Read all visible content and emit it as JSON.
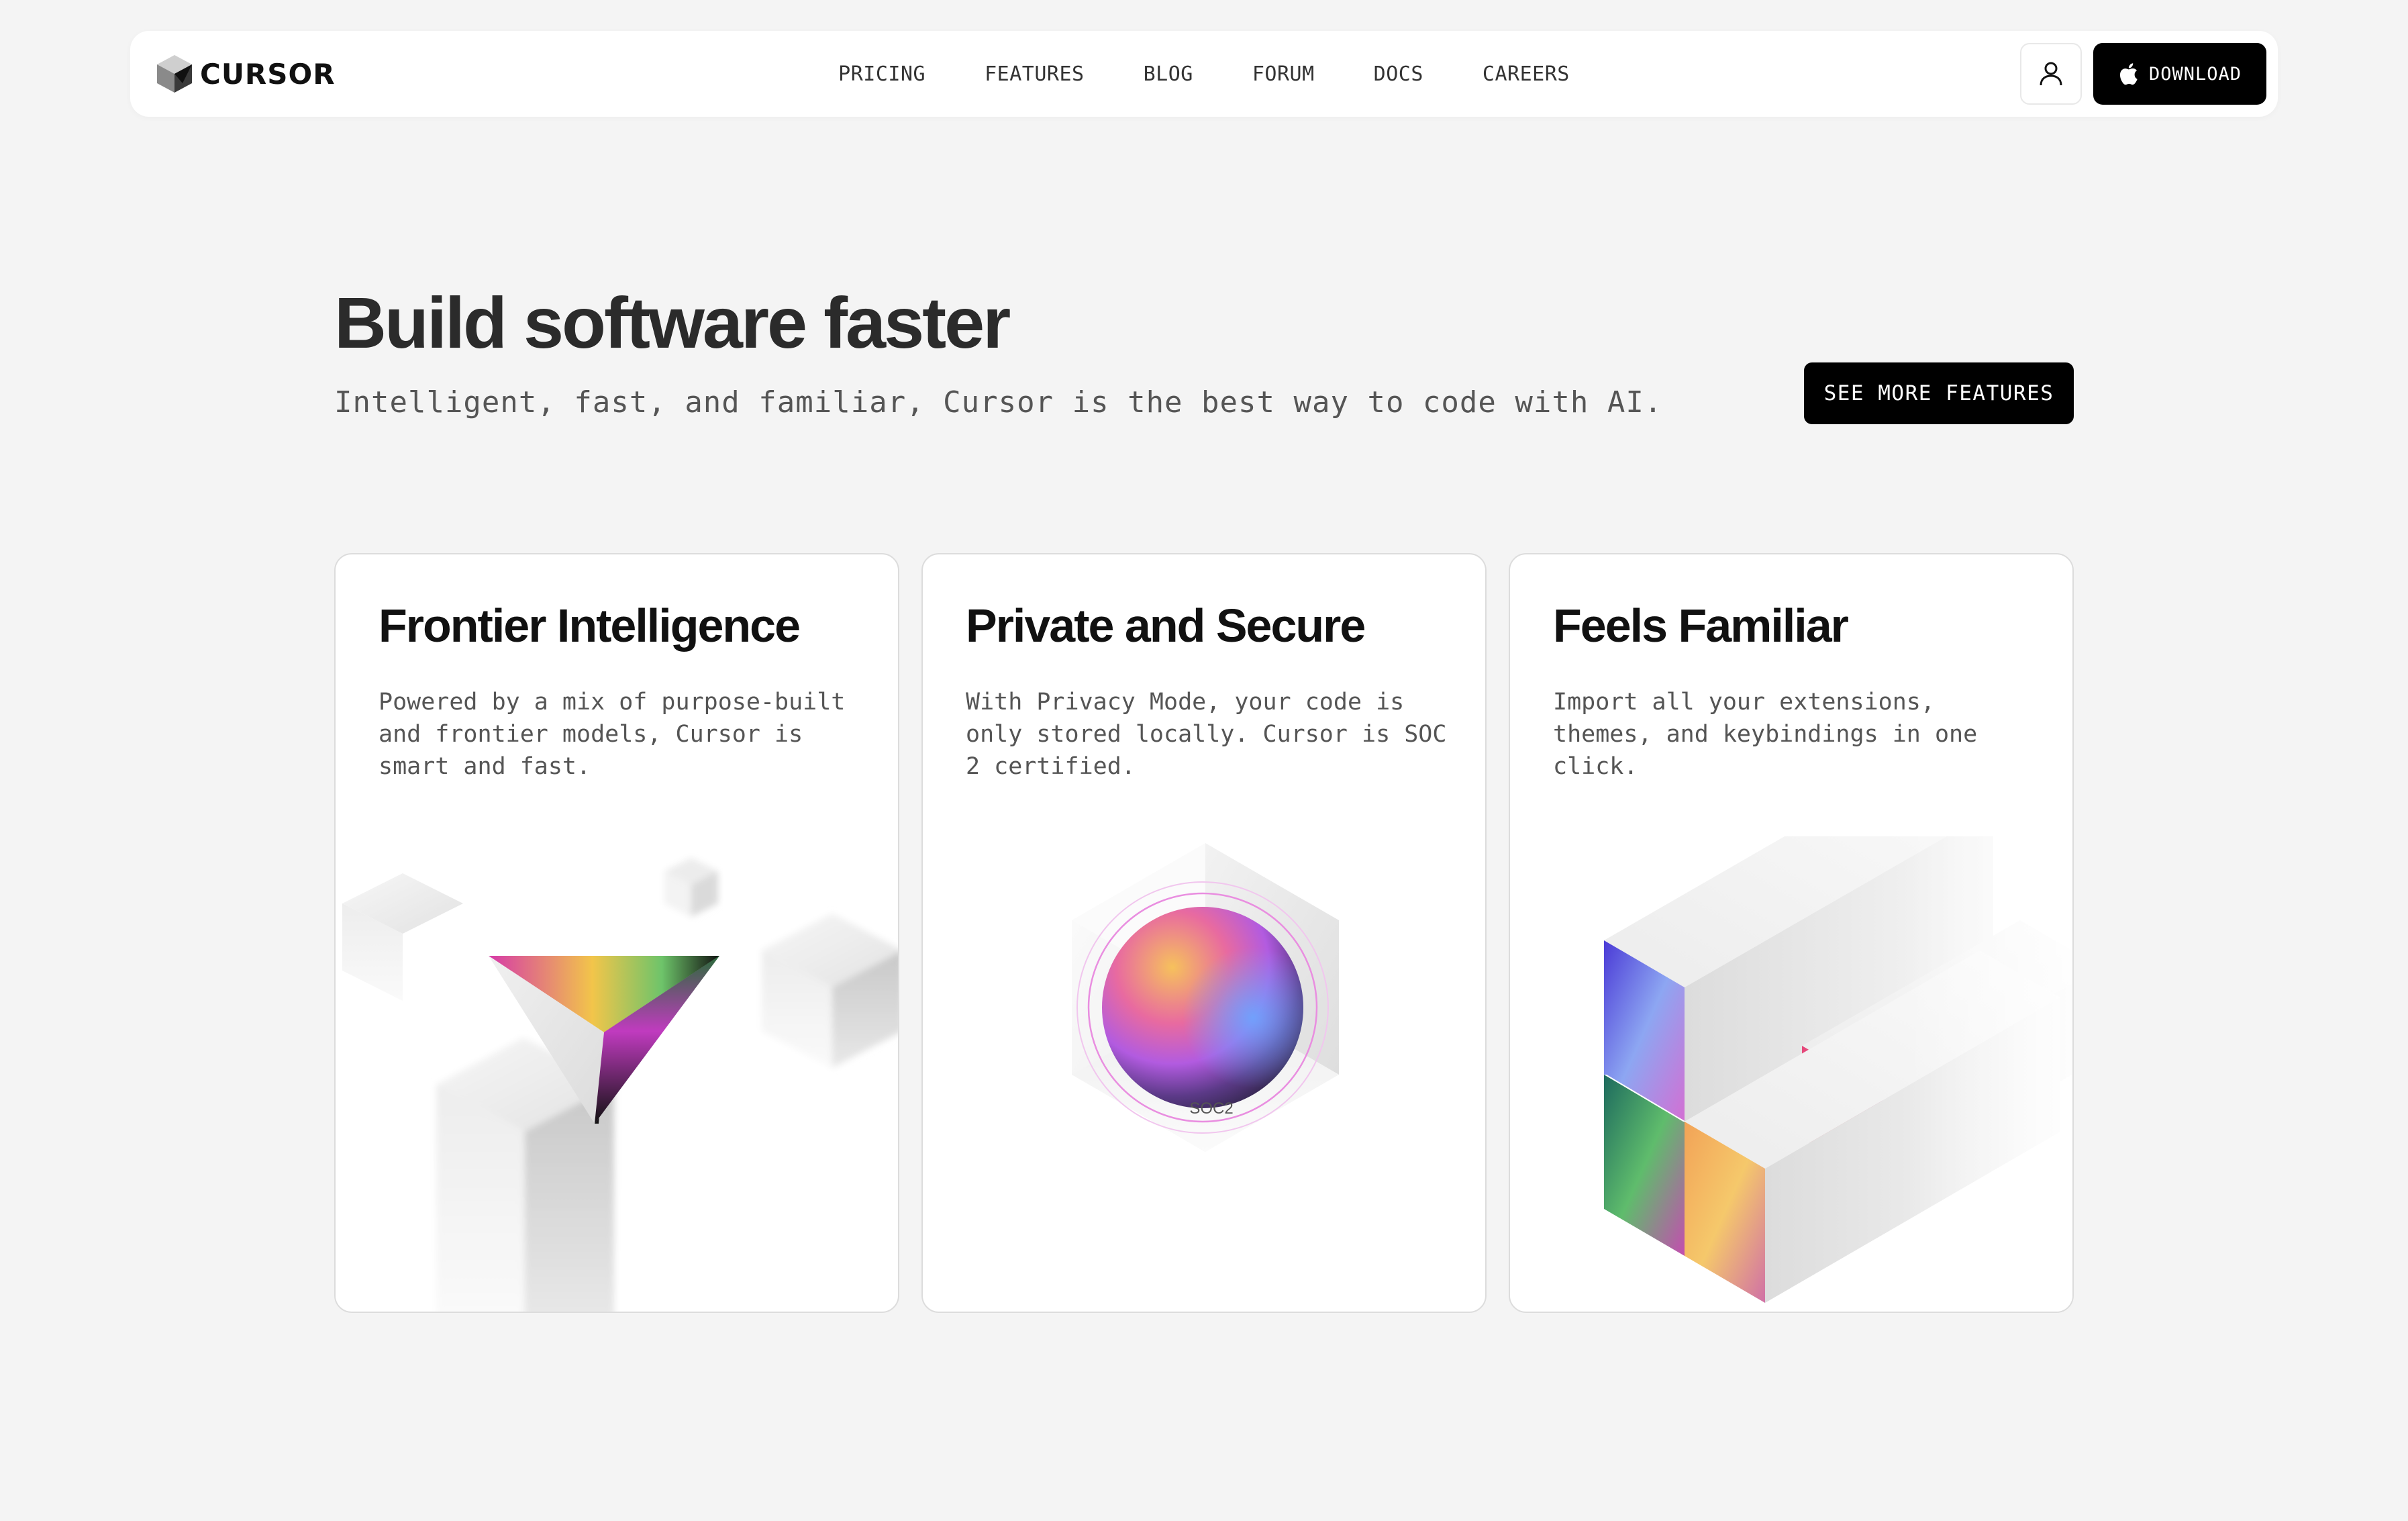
{
  "nav": {
    "logo_text": "CURSOR",
    "links": [
      "PRICING",
      "FEATURES",
      "BLOG",
      "FORUM",
      "DOCS",
      "CAREERS"
    ],
    "download_label": "DOWNLOAD",
    "user_icon": "user-icon",
    "apple_icon": "apple-icon"
  },
  "hero": {
    "title": "Build software faster",
    "subtitle": "Intelligent, fast, and familiar, Cursor is the best way to code with AI.",
    "cta_label": "SEE MORE FEATURES"
  },
  "cards": [
    {
      "title": "Frontier Intelligence",
      "description": "Powered by a mix of purpose-built and frontier models, Cursor is smart and fast."
    },
    {
      "title": "Private and Secure",
      "description": "With Privacy Mode, your code is only stored locally. Cursor is SOC 2 certified.",
      "badge": "SOC2"
    },
    {
      "title": "Feels Familiar",
      "description": "Import all your extensions, themes, and keybindings in one click."
    }
  ],
  "colors": {
    "background": "#f4f4f4",
    "surface": "#ffffff",
    "primary_button": "#000000",
    "text": "#111111",
    "muted_text": "#555555"
  }
}
